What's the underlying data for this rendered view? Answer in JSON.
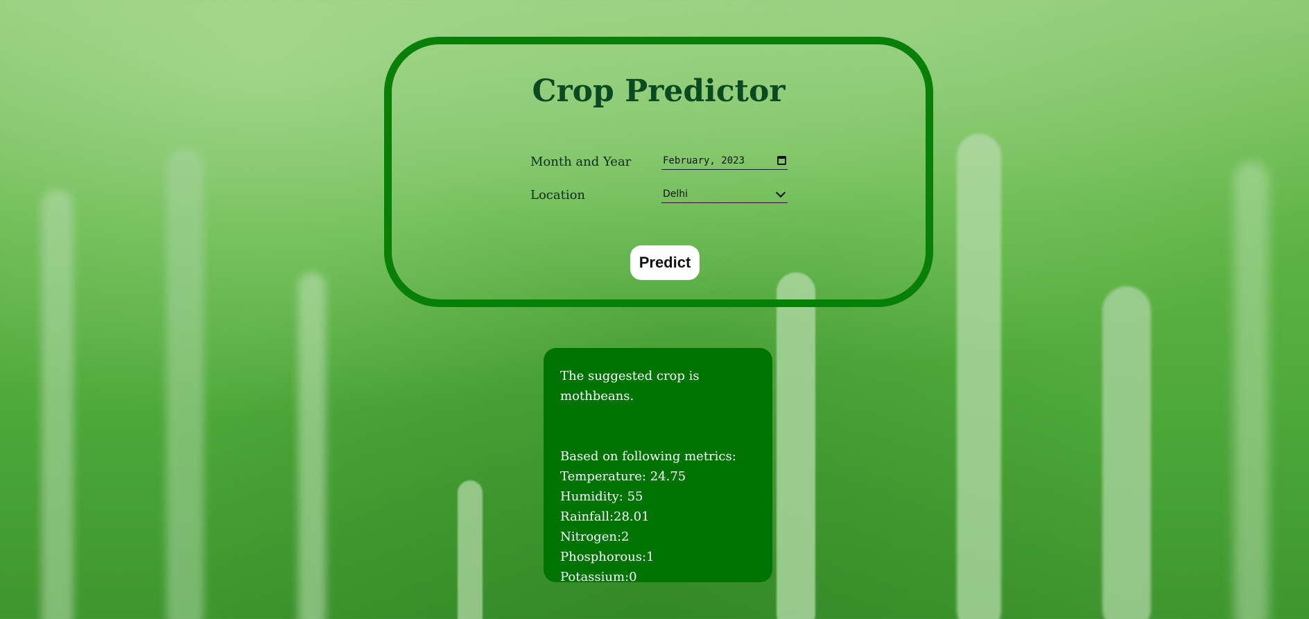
{
  "header": {
    "title": "Crop Predictor"
  },
  "form": {
    "month_year_label": "Month and Year",
    "month_year_value": "February, 2023",
    "location_label": "Location",
    "location_value": "Delhi",
    "predict_label": "Predict"
  },
  "result": {
    "suggestion": "The suggested crop is mothbeans.",
    "metrics_heading": "Based on following metrics:",
    "temperature": "Temperature: 24.75",
    "humidity": "Humidity: 55",
    "rainfall": "Rainfall:28.01",
    "nitrogen": "Nitrogen:2",
    "phosphorous": "Phosphorous:1",
    "potassium": "Potassium:0"
  },
  "icons": {
    "date": "calendar-icon",
    "select": "chevron-down-icon"
  },
  "colors": {
    "panel_border": "#088008",
    "title": "#0a4a22",
    "result_bg": "#007305",
    "button_bg": "#ffffff"
  }
}
